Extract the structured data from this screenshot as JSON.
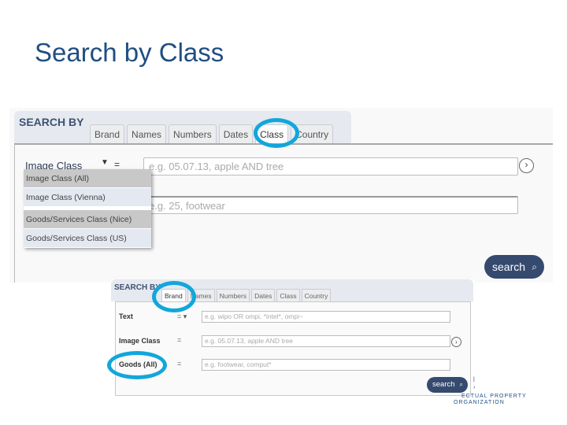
{
  "slide": {
    "title": "Search by Class"
  },
  "screenshot_main": {
    "search_by_label": "SEARCH BY",
    "tabs": [
      {
        "label": "Brand",
        "active": false
      },
      {
        "label": "Names",
        "active": false
      },
      {
        "label": "Numbers",
        "active": false
      },
      {
        "label": "Dates",
        "active": false
      },
      {
        "label": "Class",
        "active": true,
        "highlighted": true
      },
      {
        "label": "Country",
        "active": false
      }
    ],
    "field_label": "Image Class",
    "operator": "=",
    "dropdown_options": [
      {
        "label": "Image Class (All)",
        "highlighted": true
      },
      {
        "label": "Image Class (Vienna)",
        "highlighted": false
      },
      {
        "label": "Goods/Services Class (Nice)",
        "highlighted": true
      },
      {
        "label": "Goods/Services Class (US)",
        "highlighted": false
      }
    ],
    "input1_placeholder": "e.g. 05.07.13, apple AND tree",
    "input2_placeholder": "e.g. 25, footwear",
    "arrow_button": "›",
    "search_button": "search",
    "search_icon_glyph": "⌕"
  },
  "screenshot_inset": {
    "search_by_label": "SEARCH BY",
    "tabs": [
      {
        "label": "Brand",
        "active": true,
        "highlighted": true
      },
      {
        "label": "Names",
        "active": false
      },
      {
        "label": "Numbers",
        "active": false
      },
      {
        "label": "Dates",
        "active": false
      },
      {
        "label": "Class",
        "active": false
      },
      {
        "label": "Country",
        "active": false
      }
    ],
    "rows": [
      {
        "label": "Text",
        "operator": "= ▾",
        "placeholder": "e.g. wipo OR ompi, *intel*, ompi~"
      },
      {
        "label": "Image Class",
        "operator": "=",
        "placeholder": "e.g. 05.07.13, apple AND tree"
      },
      {
        "label": "Goods (All)",
        "operator": "=",
        "placeholder": "e.g. footwear, comput*",
        "highlighted": true
      }
    ],
    "arrow_button": "›",
    "search_button": "search",
    "search_icon_glyph": "⌕"
  },
  "footer": {
    "org_line1": "ECTUAL PROPERTY",
    "org_line2": "ORGANIZATION"
  },
  "colors": {
    "title": "#1f4e82",
    "highlight_ring": "#12a6dc",
    "search_button": "#354a6e"
  }
}
